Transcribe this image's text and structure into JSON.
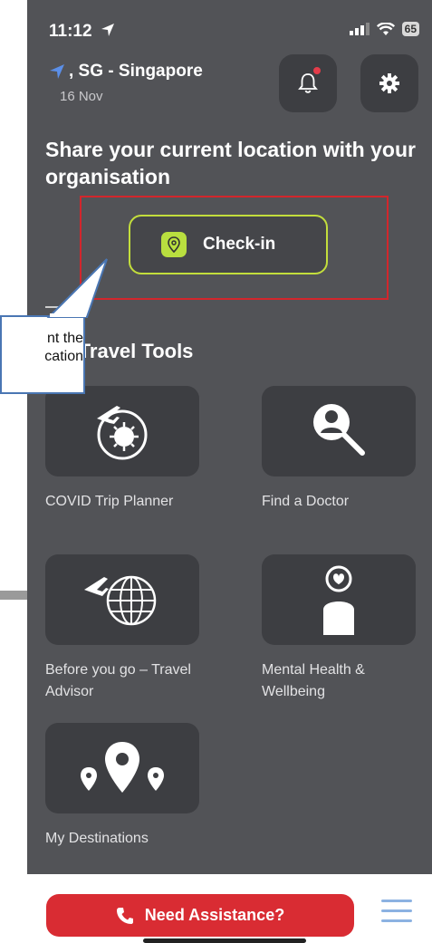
{
  "status_bar": {
    "time": "11:12",
    "battery": "65"
  },
  "location": {
    "label": ", SG - Singapore",
    "date": "16 Nov"
  },
  "share": {
    "title": "Share your current location with your organisation"
  },
  "checkin": {
    "label": "Check-in"
  },
  "tools": {
    "section_title": "My Travel Tools",
    "items": [
      {
        "label": "COVID Trip Planner",
        "icon": "covid-plane-icon"
      },
      {
        "label": "Find a Doctor",
        "icon": "doctor-search-icon"
      },
      {
        "label": "Before you go – Travel Advisor",
        "icon": "plane-globe-icon"
      },
      {
        "label": "Mental Health & Wellbeing",
        "icon": "person-heart-icon"
      },
      {
        "label": "My Destinations",
        "icon": "destination-pins-icon"
      }
    ]
  },
  "bottom": {
    "assist_label": "Need Assistance?"
  },
  "annotation": {
    "callout_text_line1": "nt the",
    "callout_text_line2": "cation"
  },
  "colors": {
    "screen_bg": "#525357",
    "tile_bg": "#3d3e42",
    "accent_green": "#c3de3c",
    "assist_red": "#d92c33",
    "highlight_red": "#d2262c",
    "callout_blue": "#4a76b3",
    "location_arrow": "#5b8fe8"
  }
}
